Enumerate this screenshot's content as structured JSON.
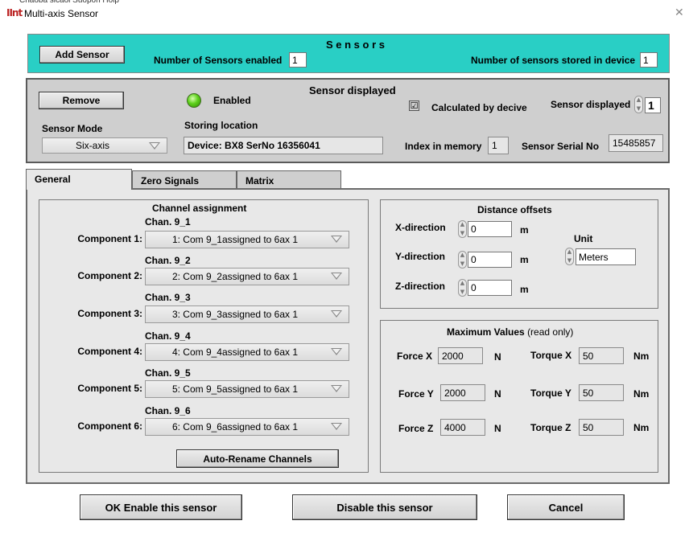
{
  "window": {
    "menu_fragment": "Chaoba  sicaoi  Suopon  Hoip",
    "app_icon_text": "IInt",
    "title": "Multi-axis Sensor",
    "close_icon": "close-icon"
  },
  "sensors": {
    "heading": "S e n s o r s",
    "add_button": "Add Sensor",
    "enabled_label": "Number of Sensors enabled",
    "enabled_value": "1",
    "stored_label": "Number of sensors stored in device",
    "stored_value": "1"
  },
  "displayed": {
    "heading": "Sensor displayed",
    "remove_button": "Remove",
    "led_color": "#5ed11c",
    "enabled_label": "Enabled",
    "calculated_label": "Calculated by decive",
    "calculated_checked": "☑",
    "sensor_displayed_label": "Sensor displayed",
    "sensor_displayed_value": "1",
    "mode_label": "Sensor Mode",
    "mode_value": "Six-axis",
    "storing_label": "Storing location",
    "storing_value": "Device: BX8 SerNo 16356041",
    "index_label": "Index in memory",
    "index_value": "1",
    "serial_label": "Sensor Serial No",
    "serial_value": "15485857"
  },
  "tabs": [
    {
      "label": "General",
      "active": true
    },
    {
      "label": "Zero Signals",
      "active": false
    },
    {
      "label": "Matrix",
      "active": false
    }
  ],
  "channels": {
    "heading": "Channel assignment",
    "items": [
      {
        "chan": "Chan. 9_1",
        "label": "Component 1:",
        "value": "1: Com 9_1assigned to 6ax 1"
      },
      {
        "chan": "Chan. 9_2",
        "label": "Component 2:",
        "value": "2: Com 9_2assigned to 6ax 1"
      },
      {
        "chan": "Chan. 9_3",
        "label": "Component 3:",
        "value": "3: Com 9_3assigned to 6ax 1"
      },
      {
        "chan": "Chan. 9_4",
        "label": "Component 4:",
        "value": "4: Com 9_4assigned to 6ax 1"
      },
      {
        "chan": "Chan. 9_5",
        "label": "Component 5:",
        "value": "5: Com 9_5assigned to 6ax 1"
      },
      {
        "chan": "Chan. 9_6",
        "label": "Component 6:",
        "value": "6: Com 9_6assigned to 6ax 1"
      }
    ],
    "auto_rename": "Auto-Rename Channels"
  },
  "offsets": {
    "heading": "Distance offsets",
    "x_label": "X-direction",
    "x_value": "0",
    "x_unit": "m",
    "y_label": "Y-direction",
    "y_value": "0",
    "y_unit": "m",
    "z_label": "Z-direction",
    "z_value": "0",
    "z_unit": "m",
    "unit_label": "Unit",
    "unit_value": "Meters"
  },
  "maximum": {
    "heading_bold": "Maximum Values",
    "heading_note": "(read only)",
    "fx_label": "Force X",
    "fx_value": "2000",
    "fx_unit": "N",
    "fy_label": "Force Y",
    "fy_value": "2000",
    "fy_unit": "N",
    "fz_label": "Force Z",
    "fz_value": "4000",
    "fz_unit": "N",
    "tx_label": "Torque X",
    "tx_value": "50",
    "tx_unit": "Nm",
    "ty_label": "Torque Y",
    "ty_value": "50",
    "ty_unit": "Nm",
    "tz_label": "Torque Z",
    "tz_value": "50",
    "tz_unit": "Nm"
  },
  "footer": {
    "ok_button": "OK Enable this sensor",
    "disable_button": "Disable this sensor",
    "cancel_button": "Cancel"
  },
  "colors": {
    "sensors_header": "#29cfc5",
    "panel": "#cfcfcf",
    "tab_body": "#e8e8e8"
  }
}
